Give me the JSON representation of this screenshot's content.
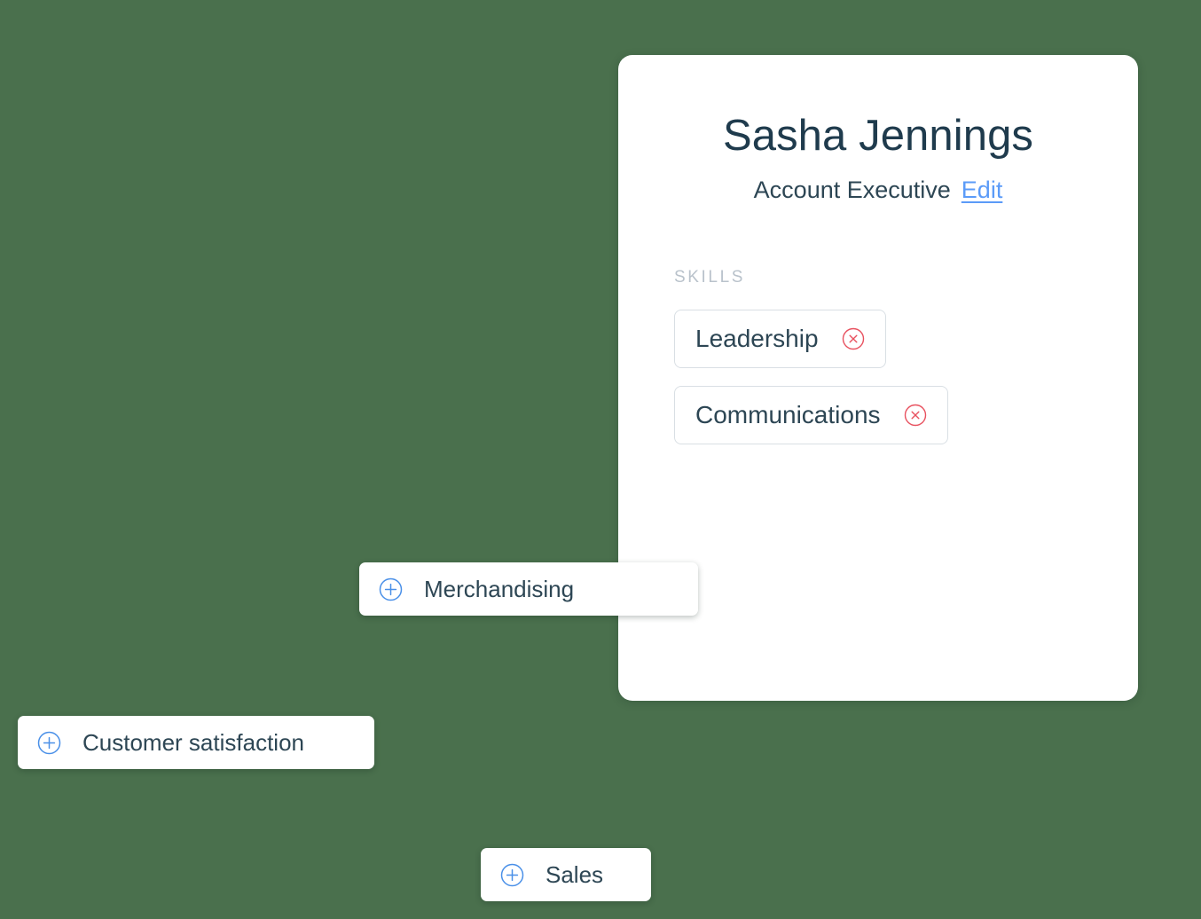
{
  "background": {
    "color": "#4a704d"
  },
  "profile": {
    "name": "Sasha Jennings",
    "role": "Account Executive",
    "edit_label": "Edit",
    "skills_label": "SKILLS",
    "skills": [
      {
        "label": "Leadership",
        "remove_icon": "remove-circle-icon"
      },
      {
        "label": "Communications",
        "remove_icon": "remove-circle-icon"
      }
    ]
  },
  "suggestions": [
    {
      "label": "Merchandising",
      "add_icon": "add-circle-icon"
    },
    {
      "label": "Customer satisfaction",
      "add_icon": "add-circle-icon"
    },
    {
      "label": "Sales",
      "add_icon": "add-circle-icon"
    }
  ],
  "colors": {
    "background_green": "#4a704d",
    "card_white": "#ffffff",
    "text_dark": "#2d4654",
    "heading_dark": "#1f3b4d",
    "link_blue": "#5b9bf8",
    "label_gray": "#b9c2cb",
    "chip_border": "#d9dfe4",
    "remove_red": "#e8515f",
    "add_blue": "#4a90e8"
  }
}
